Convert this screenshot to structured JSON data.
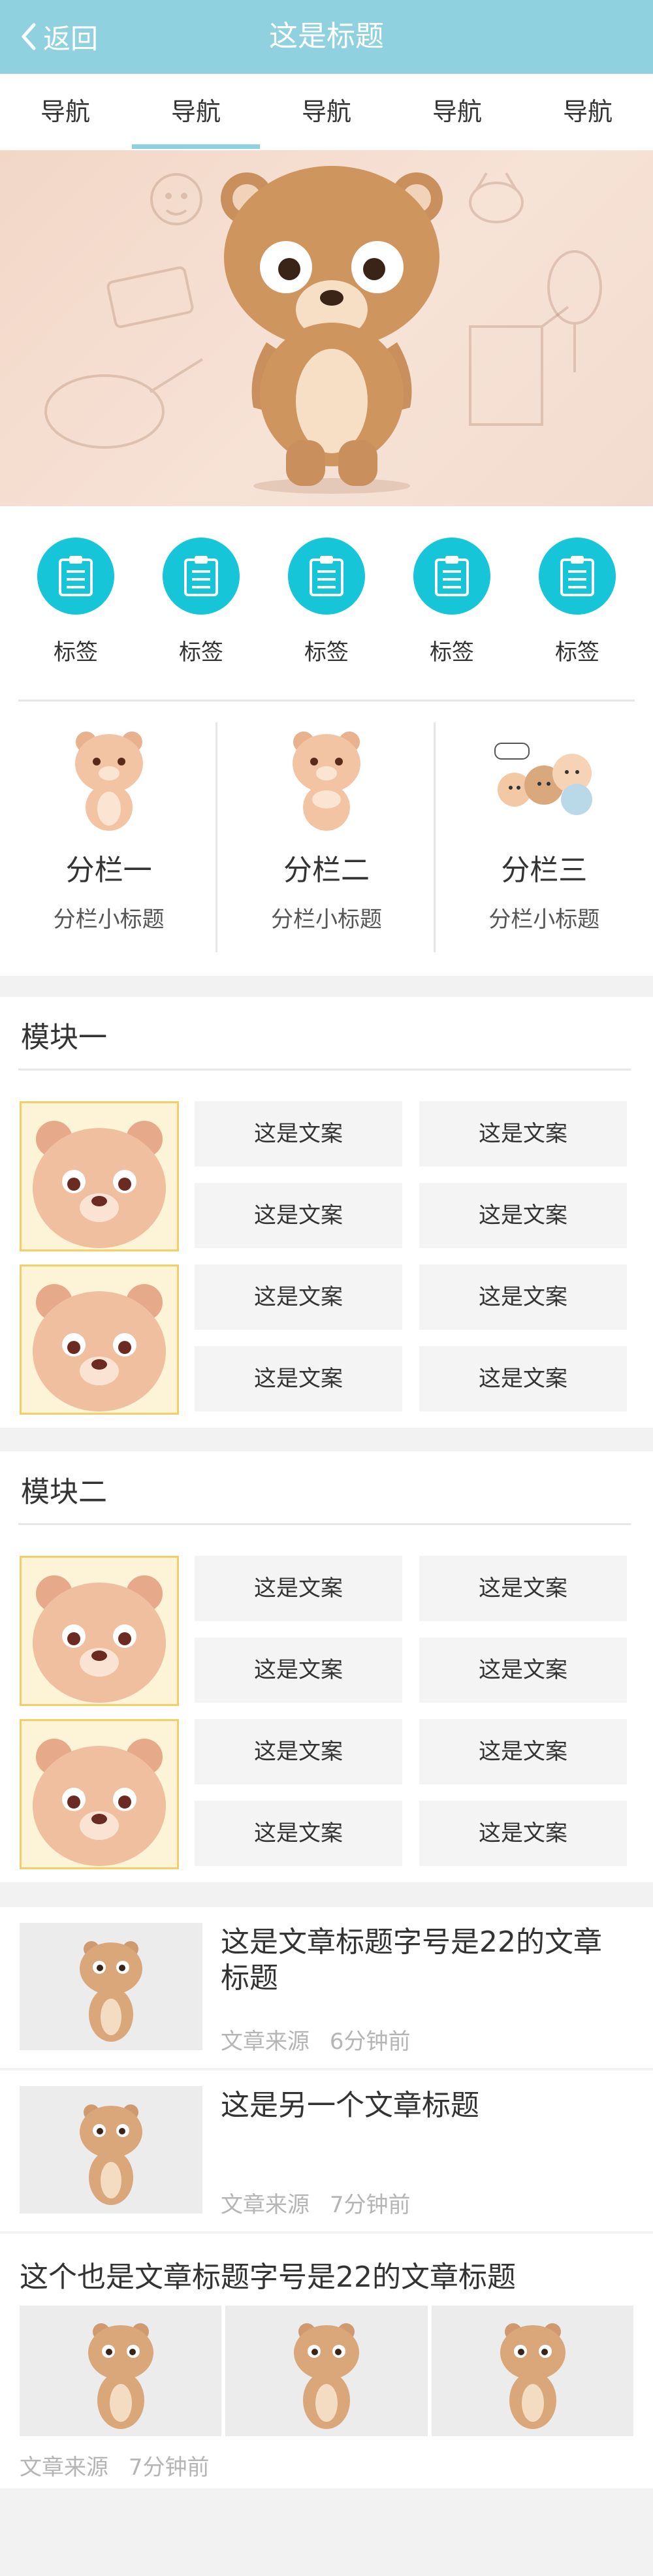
{
  "header": {
    "back_label": "返回",
    "title": "这是标题"
  },
  "nav": {
    "items": [
      "导航",
      "导航",
      "导航",
      "导航",
      "导航"
    ]
  },
  "tags": {
    "items": [
      "标签",
      "标签",
      "标签",
      "标签",
      "标签"
    ]
  },
  "columns": [
    {
      "title": "分栏一",
      "subtitle": "分栏小标题"
    },
    {
      "title": "分栏二",
      "subtitle": "分栏小标题"
    },
    {
      "title": "分栏三",
      "subtitle": "分栏小标题"
    }
  ],
  "module1": {
    "title": "模块一",
    "buttons": [
      "这是文案",
      "这是文案",
      "这是文案",
      "这是文案",
      "这是文案",
      "这是文案",
      "这是文案",
      "这是文案"
    ]
  },
  "module2": {
    "title": "模块二",
    "buttons": [
      "这是文案",
      "这是文案",
      "这是文案",
      "这是文案",
      "这是文案",
      "这是文案",
      "这是文案",
      "这是文案"
    ]
  },
  "articles": [
    {
      "title": "这是文章标题字号是22的文章标题",
      "source": "文章来源",
      "time": "6分钟前"
    },
    {
      "title": "这是另一个文章标题",
      "source": "文章来源",
      "time": "7分钟前"
    },
    {
      "title": "这个也是文章标题字号是22的文章标题",
      "source": "文章来源",
      "time": "7分钟前"
    }
  ],
  "colors": {
    "header": "#8fd1de",
    "accent": "#16c6d8",
    "tab_indicator": "#8fd1de"
  }
}
